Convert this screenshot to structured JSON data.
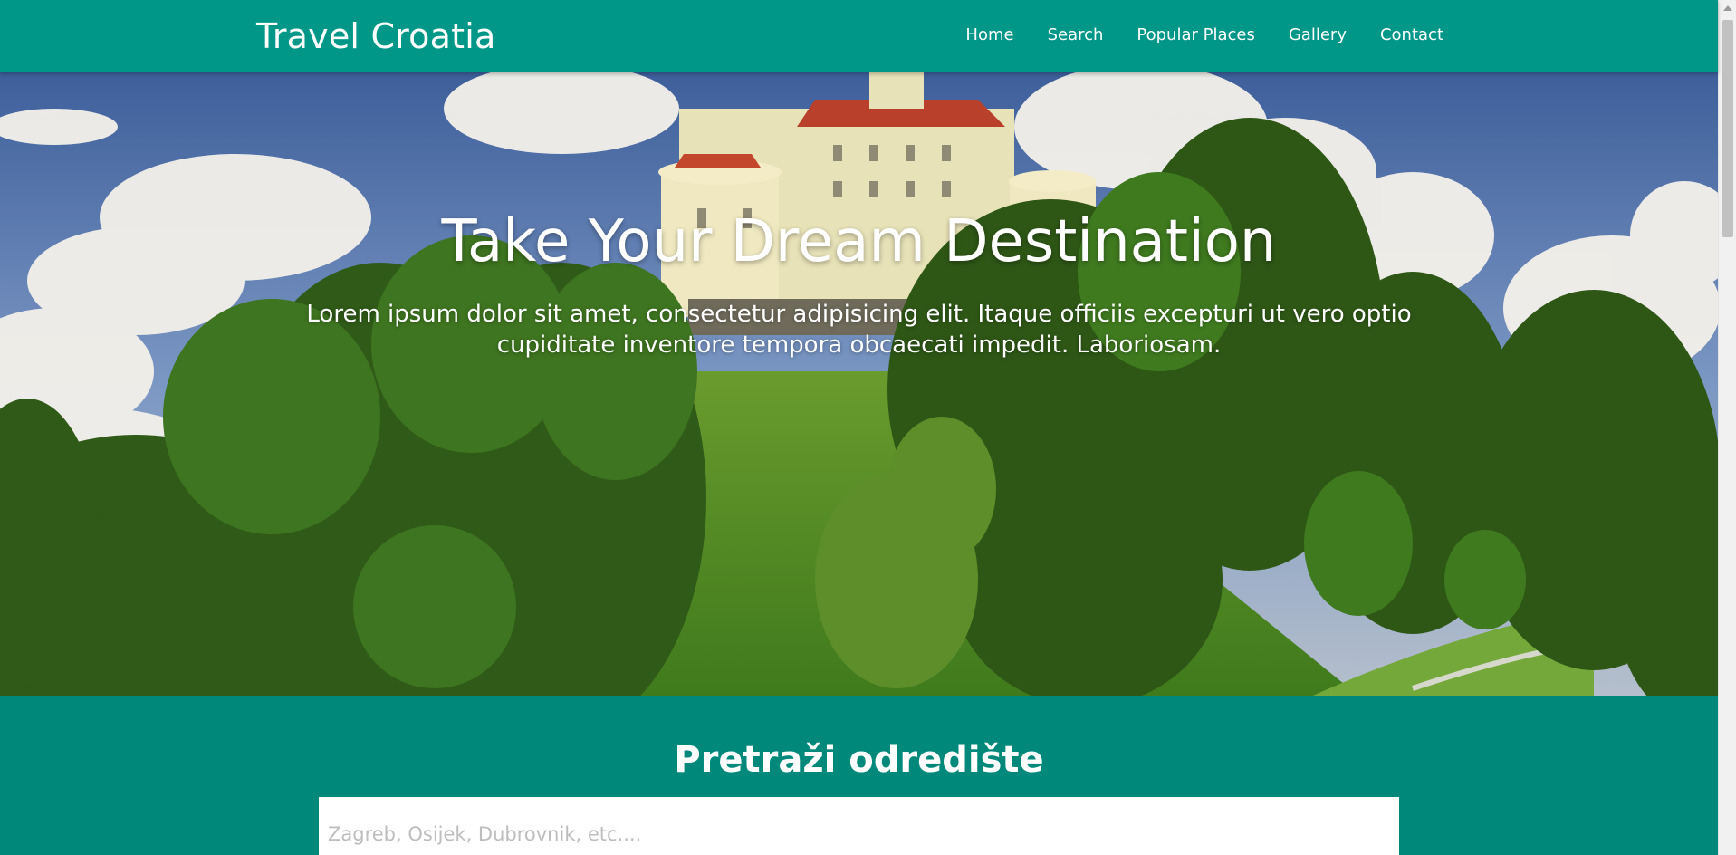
{
  "navbar": {
    "brand": "Travel Croatia",
    "links": [
      {
        "label": "Home"
      },
      {
        "label": "Search"
      },
      {
        "label": "Popular Places"
      },
      {
        "label": "Gallery"
      },
      {
        "label": "Contact"
      }
    ]
  },
  "hero": {
    "title": "Take Your Dream Destination",
    "text": "Lorem ipsum dolor sit amet, consectetur adipisicing elit. Itaque officiis excepturi ut vero optio cupiditate inventore tempora obcaecati impedit. Laboriosam."
  },
  "search": {
    "title": "Pretraži odredište",
    "placeholder": "Zagreb, Osijek, Dubrovnik, etc...."
  },
  "colors": {
    "primary": "#009688",
    "section": "#00897b"
  }
}
